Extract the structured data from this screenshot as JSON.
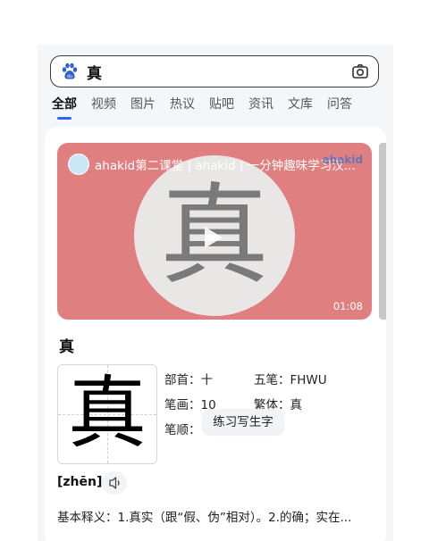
{
  "search": {
    "query": "真"
  },
  "tabs": [
    "全部",
    "视频",
    "图片",
    "热议",
    "贴吧",
    "资讯",
    "文库",
    "问答"
  ],
  "video": {
    "title": "ahakid第二课堂 | ahakid | 一分钟趣味学习汉...",
    "watermark": "ahakid",
    "thumbnail_char": "真",
    "duration": "01:08"
  },
  "character": {
    "char": "真",
    "radical": "部首：十",
    "wubi": "五笔：FHWU",
    "strokes": "笔画：10",
    "traditional": "繁体：真",
    "stroke_order_label": "笔顺：",
    "practice_button": "练习写生字",
    "pinyin": "[zhēn]",
    "meaning": "基本释义：1.真实（跟“假、伪”相对）。2.的确；实在..."
  },
  "colors": {
    "accent": "#3064f0",
    "video_bg": "#e07f7f"
  }
}
